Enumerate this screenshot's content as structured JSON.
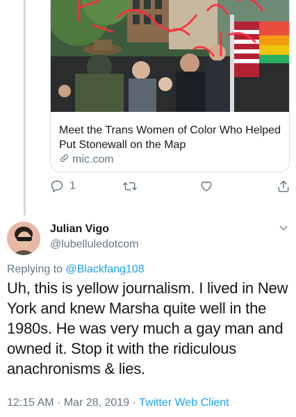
{
  "link_card": {
    "title": "Meet the Trans Women of Color Who Helped Put Stonewall on the Map",
    "domain": "mic.com",
    "image_icon": "photo-stonewall-crowd"
  },
  "tweet_actions": {
    "reply_count": "1",
    "reply_icon": "reply-icon",
    "retweet_icon": "retweet-icon",
    "like_icon": "heart-icon",
    "share_icon": "share-icon"
  },
  "reply_tweet": {
    "display_name": "Julian Vigo",
    "handle": "@lubelluledotcom",
    "replying_prefix": "Replying to",
    "replying_mention": "@Blackfang108",
    "text": "Uh, this is yellow journalism. I lived in New York and knew Marsha quite well in the 1980s. He was very much a gay man and owned it. Stop it with the ridiculous anachronisms & lies.",
    "timestamp": "12:15 AM · Mar 28, 2019 · ",
    "client": "Twitter Web Client"
  },
  "colors": {
    "accent": "#1da1f2",
    "secondary_text": "#657786",
    "border": "#d6dde3"
  }
}
